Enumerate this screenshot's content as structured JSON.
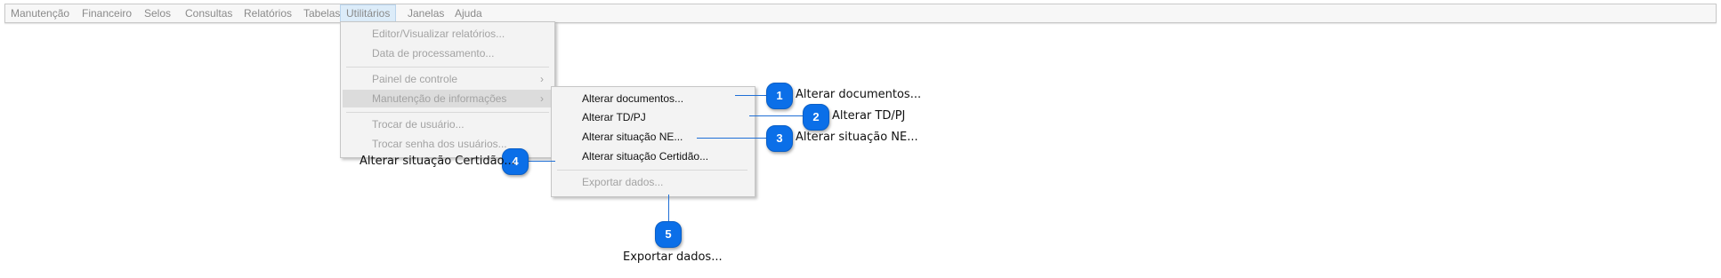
{
  "menubar": {
    "items": [
      {
        "label": "Manutenção"
      },
      {
        "label": "Financeiro"
      },
      {
        "label": "Selos"
      },
      {
        "label": "Consultas"
      },
      {
        "label": "Relatórios"
      },
      {
        "label": "Tabelas"
      },
      {
        "label": "Utilitários",
        "active": true
      },
      {
        "label": "Janelas"
      },
      {
        "label": "Ajuda"
      }
    ]
  },
  "utilitarios_menu": {
    "items": [
      {
        "label": "Editor/Visualizar relatórios..."
      },
      {
        "label": "Data de processamento..."
      },
      {
        "label": "Painel de controle",
        "has_submenu": true
      },
      {
        "label": "Manutenção de informações",
        "has_submenu": true,
        "highlighted": true
      },
      {
        "label": "Trocar de usuário..."
      },
      {
        "label": "Trocar senha dos usuários..."
      }
    ],
    "chevron": "›"
  },
  "submenu": {
    "items": [
      {
        "label": "Alterar documentos..."
      },
      {
        "label": "Alterar TD/PJ"
      },
      {
        "label": "Alterar situação NE..."
      },
      {
        "label": "Alterar situação Certidão..."
      },
      {
        "label": "Exportar dados...",
        "disabled": true
      }
    ]
  },
  "callouts": [
    {
      "number": "1",
      "label": "Alterar documentos..."
    },
    {
      "number": "2",
      "label": "Alterar TD/PJ"
    },
    {
      "number": "3",
      "label": "Alterar situação NE..."
    },
    {
      "number": "4",
      "label": "Alterar situação Certidão..."
    },
    {
      "number": "5",
      "label": "Exportar dados..."
    }
  ],
  "colors": {
    "badge": "#0b6fe8",
    "leader": "#1f6fd6",
    "menu_bg": "#f3f3f3",
    "disabled_text": "#a3a3a3"
  }
}
